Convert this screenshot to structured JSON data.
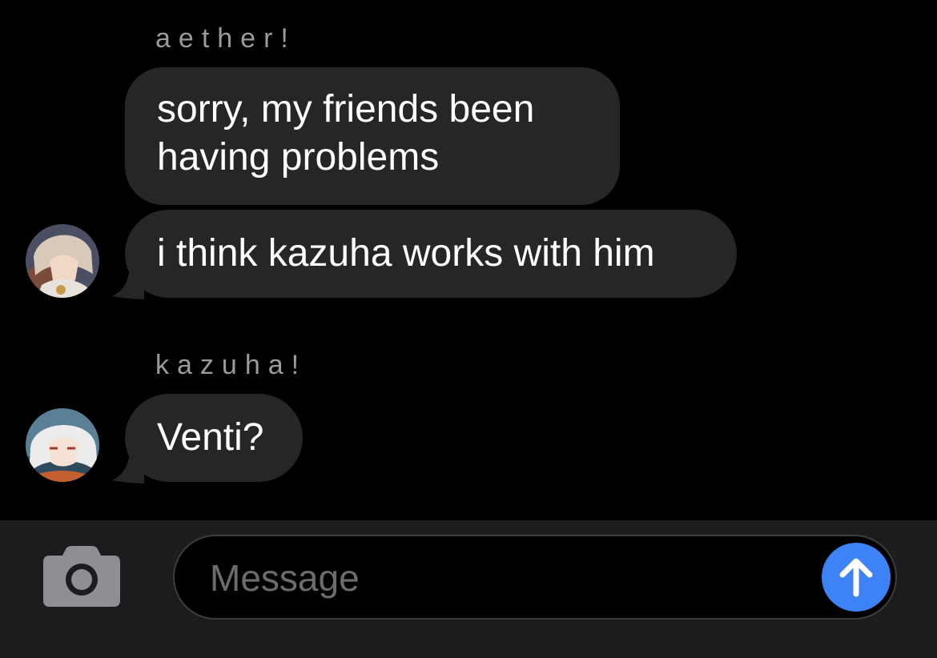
{
  "conversation": {
    "groups": [
      {
        "sender": "aether!",
        "messages": [
          "sorry, my friends been\nhaving problems",
          "i think kazuha works with him"
        ]
      },
      {
        "sender": "kazuha!",
        "messages": [
          "Venti?"
        ]
      }
    ]
  },
  "composer": {
    "placeholder": "Message",
    "icons": {
      "camera": "camera-icon",
      "send": "arrow-up-icon"
    }
  },
  "colors": {
    "background": "#000000",
    "bubble": "#262629",
    "send_accent": "#3e82f7",
    "input_bar": "#1c1c1e"
  }
}
